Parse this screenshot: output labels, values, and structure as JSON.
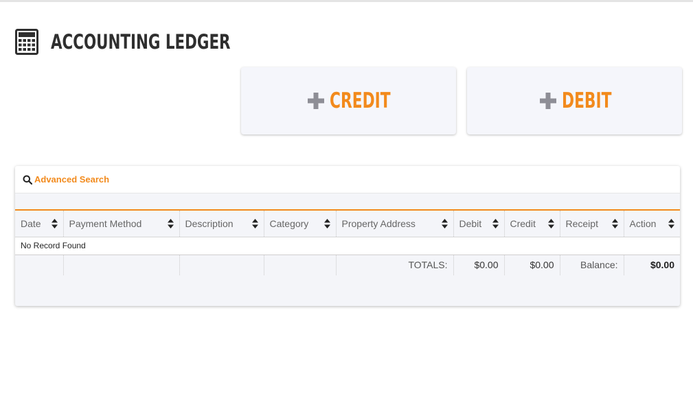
{
  "header": {
    "title": "ACCOUNTING LEDGER",
    "icon": "calculator-icon"
  },
  "actions": {
    "credit": {
      "label": "CREDIT",
      "icon": "plus-icon"
    },
    "debit": {
      "label": "DEBIT",
      "icon": "plus-icon"
    }
  },
  "search": {
    "label": "Advanced Search",
    "icon": "search-icon"
  },
  "table": {
    "columns": [
      "Date",
      "Payment Method",
      "Description",
      "Category",
      "Property Address",
      "Debit",
      "Credit",
      "Receipt",
      "Action"
    ],
    "empty_message": "No Record Found",
    "totals": {
      "label": "TOTALS:",
      "debit": "$0.00",
      "credit": "$0.00",
      "balance_label": "Balance:",
      "balance": "$0.00"
    }
  },
  "colors": {
    "accent": "#f28a1c",
    "card_bg": "#f5f6fb",
    "icon_gray": "#8e8e96",
    "title": "#2f2f2f"
  }
}
